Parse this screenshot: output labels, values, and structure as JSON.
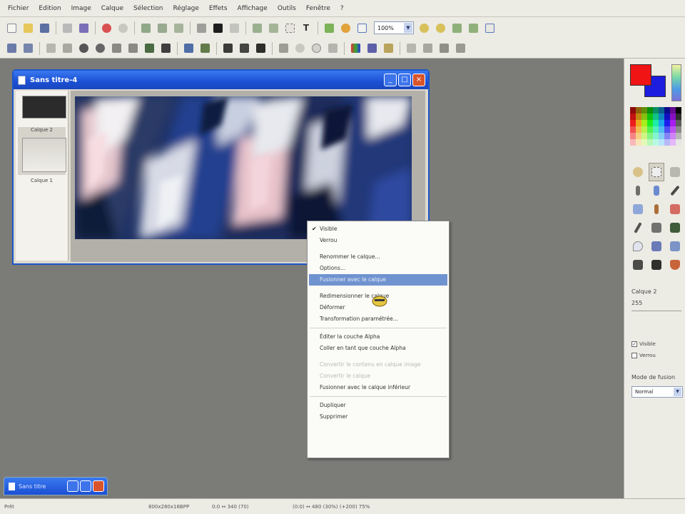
{
  "menubar": {
    "items": [
      "Fichier",
      "Edition",
      "Image",
      "Calque",
      "Sélection",
      "Réglage",
      "Effets",
      "Affichage",
      "Outils",
      "Fenêtre",
      "?"
    ]
  },
  "toolbar": {
    "zoom_value": "100%"
  },
  "image_window": {
    "title": "Sans titre-4",
    "layers": [
      {
        "label": ""
      },
      {
        "label": "Calque 2"
      },
      {
        "label": "Calque 1"
      }
    ]
  },
  "context_menu": {
    "items": [
      {
        "label": "Visible",
        "checked": true
      },
      {
        "label": "Verrou"
      },
      {
        "label": "Renommer le calque..."
      },
      {
        "label": "Options..."
      },
      {
        "label": "Fusionner avec le calque",
        "highlighted": true
      },
      {
        "label": "Redimensionner le calque"
      },
      {
        "label": "Déformer"
      },
      {
        "label": "Transformation paramétrée..."
      },
      {
        "label": "Éditer la couche Alpha"
      },
      {
        "label": "Coller en tant que couche Alpha"
      },
      {
        "label": "Convertir le contenu en calque image",
        "disabled": true
      },
      {
        "label": "Convertir le calque",
        "disabled": true
      },
      {
        "label": "Fusionner avec le calque inférieur"
      },
      {
        "label": "Dupliquer"
      },
      {
        "label": "Supprimer"
      }
    ]
  },
  "right_panel": {
    "layer_name": "Calque 2",
    "opacity": "255",
    "visible_label": "Visible",
    "lock_label": "Verrou",
    "mode_label": "Mode de fusion",
    "mode_value": "Normal",
    "fg_color": "#f01414",
    "bg_color": "#1d1de0"
  },
  "minimized_window": {
    "title": "Sans titre"
  },
  "statusbar": {
    "mode": "Prêt",
    "size": "800x280x16BPP",
    "coords": "0:0 ↔ 340 (70)",
    "zoom_info": "(0:0) ↔ 480 (30%) (+200) 75%"
  }
}
